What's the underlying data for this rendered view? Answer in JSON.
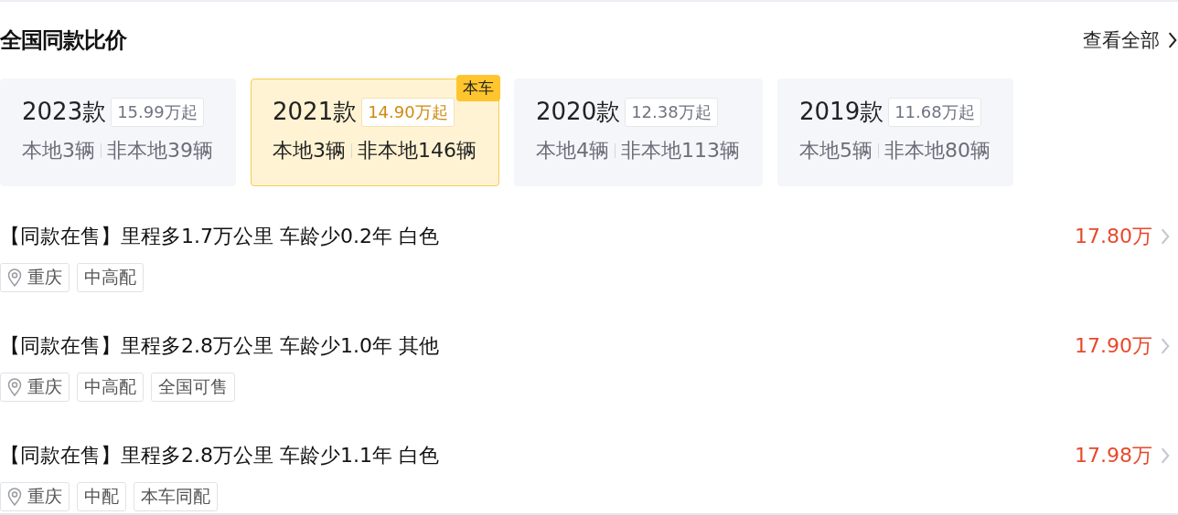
{
  "header": {
    "title": "全国同款比价",
    "view_all": "查看全部"
  },
  "models": [
    {
      "year": "2023款",
      "price": "15.99万起",
      "local": "本地3辆",
      "nonlocal": "非本地39辆",
      "selected": false
    },
    {
      "year": "2021款",
      "price": "14.90万起",
      "local": "本地3辆",
      "nonlocal": "非本地146辆",
      "selected": true,
      "badge": "本车"
    },
    {
      "year": "2020款",
      "price": "12.38万起",
      "local": "本地4辆",
      "nonlocal": "非本地113辆",
      "selected": false
    },
    {
      "year": "2019款",
      "price": "11.68万起",
      "local": "本地5辆",
      "nonlocal": "非本地80辆",
      "selected": false
    }
  ],
  "listings": [
    {
      "title": "【同款在售】里程多1.7万公里 车龄少0.2年 白色",
      "price": "17.80万",
      "tags": [
        {
          "kind": "location",
          "text": "重庆"
        },
        {
          "kind": "plain",
          "text": "中高配"
        }
      ]
    },
    {
      "title": "【同款在售】里程多2.8万公里 车龄少1.0年 其他",
      "price": "17.90万",
      "tags": [
        {
          "kind": "location",
          "text": "重庆"
        },
        {
          "kind": "plain",
          "text": "中高配"
        },
        {
          "kind": "plain",
          "text": "全国可售"
        }
      ]
    },
    {
      "title": "【同款在售】里程多2.8万公里 车龄少1.1年 白色",
      "price": "17.98万",
      "tags": [
        {
          "kind": "location",
          "text": "重庆"
        },
        {
          "kind": "plain",
          "text": "中配"
        },
        {
          "kind": "plain",
          "text": "本车同配"
        }
      ]
    }
  ]
}
